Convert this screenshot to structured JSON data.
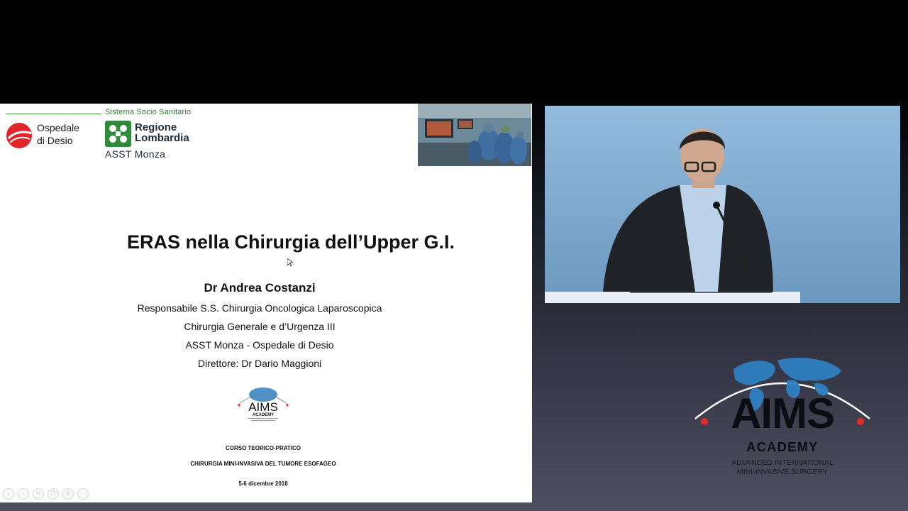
{
  "slide": {
    "hospital_name_line1": "Ospedale",
    "hospital_name_line2": "di Desio",
    "system_title": "Sistema Socio Sanitario",
    "region_line1": "Regione",
    "region_line2": "Lombardia",
    "asst": "ASST Monza",
    "title": "ERAS nella Chirurgia dell’Upper G.I.",
    "speaker": "Dr Andrea Costanzi",
    "affiliations": [
      "Responsabile S.S. Chirurgia Oncologica Laparoscopica",
      "Chirurgia Generale e d’Urgenza III",
      "ASST Monza - Ospedale di Desio",
      "Direttore: Dr Dario Maggioni"
    ],
    "logo_small": {
      "word": "AIMS",
      "academy": "ACADEMY"
    },
    "course_type": "CORSO TEORICO-PRATICO",
    "course_name": "CHIRURGIA MINI-INVASIVA DEL TUMORE ESOFAGEO",
    "course_dates": "5-6 dicembre 2018"
  },
  "branding": {
    "word": "AIMS",
    "academy": "ACADEMY",
    "tagline_line1": "ADVANCED INTERNATIONAL",
    "tagline_line2": "MINI-INVASIVE SURGERY"
  },
  "icons": {
    "hospital_logo": "red-sphere-logo",
    "region_logo": "green-cross-logo",
    "globe": "world-map-icon",
    "toolbar": [
      "prev-icon",
      "next-icon",
      "pen-icon",
      "copy-icon",
      "zoom-icon",
      "more-icon"
    ]
  },
  "colors": {
    "hospital_red": "#e0262a",
    "region_green": "#2f8a3a",
    "globe_blue": "#2f7fc1",
    "accent_red": "#e02b2b"
  }
}
